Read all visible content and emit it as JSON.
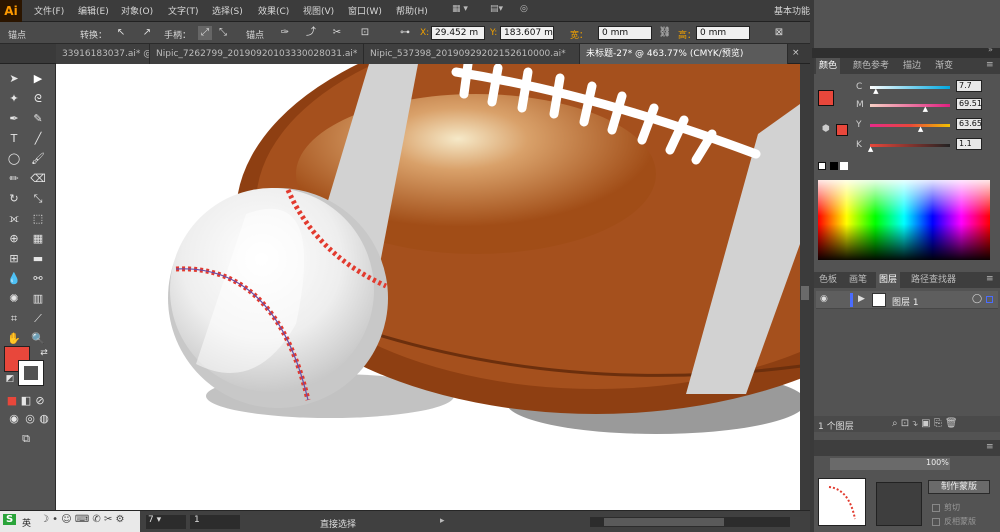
{
  "app": {
    "logo": "Ai",
    "workspace": "基本功能",
    "search_placeholder": ""
  },
  "menu": [
    "文件(F)",
    "编辑(E)",
    "对象(O)",
    "文字(T)",
    "选择(S)",
    "效果(C)",
    "视图(V)",
    "窗口(W)",
    "帮助(H)"
  ],
  "control_bar": {
    "context": "锚点",
    "convert": "转换：",
    "handles": "手柄：",
    "anchors": "锚点",
    "x_label": "X:",
    "x_value": "29.452 m",
    "y_label": "Y:",
    "y_value": "183.607 m",
    "w_label": "宽：",
    "w_value": "0 mm",
    "h_label": "高：",
    "h_value": "0 mm"
  },
  "tabs": [
    "33916183037.ai* @",
    "Nipic_7262799_20190920103330028031.ai*",
    "Nipic_537398_20190929202152610000.ai*",
    "未标题-27* @ 463.77% (CMYK/预览)"
  ],
  "status": {
    "zoom": "463.77%",
    "page": "1",
    "mode": "直接选择"
  },
  "colors": {
    "fill": "#e8473b",
    "stroke": "#ffffff",
    "football": "#a5501d",
    "baseball": "#f0f0f0",
    "stitch": "#e23a2e"
  },
  "color_panel": {
    "tabs": [
      "颜色",
      "颜色参考",
      "描边",
      "渐变"
    ],
    "C": "7.7",
    "M": "69.51",
    "Y": "63.65",
    "K": "1.1",
    "C_pct": 7.7,
    "M_pct": 69.51,
    "Y_pct": 63.65,
    "K_pct": 1.1
  },
  "layers_panel": {
    "tabs": [
      "色板",
      "画笔",
      "图层",
      "路径查找器"
    ],
    "layer_name": "图层 1",
    "count": "1 个图层"
  },
  "nav_panel": {
    "zoom": "100%",
    "make_mask": "制作蒙版",
    "clip": "剪切",
    "invert": "反相蒙版"
  },
  "ime": {
    "lang": "英"
  }
}
